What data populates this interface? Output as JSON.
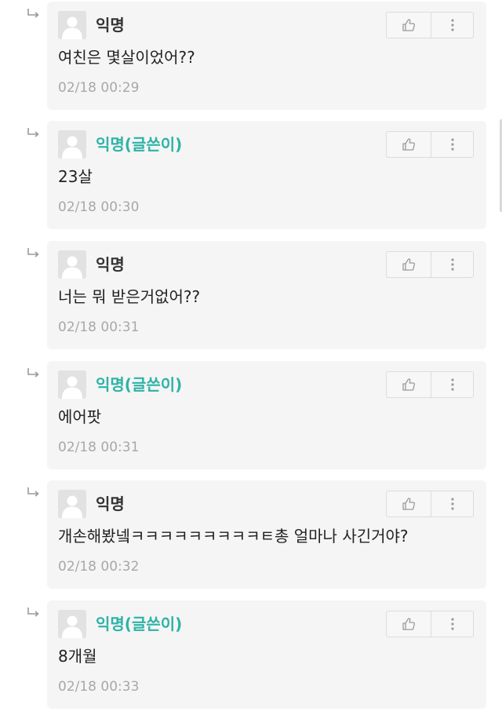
{
  "comments": [
    {
      "nickname": "익명",
      "is_writer": false,
      "text": "여친은 몇살이었어??",
      "time": "02/18 00:29"
    },
    {
      "nickname": "익명(글쓴이)",
      "is_writer": true,
      "text": "23살",
      "time": "02/18 00:30"
    },
    {
      "nickname": "익명",
      "is_writer": false,
      "text": "너는 뭐 받은거없어??",
      "time": "02/18 00:31"
    },
    {
      "nickname": "익명(글쓴이)",
      "is_writer": true,
      "text": "에어팟",
      "time": "02/18 00:31"
    },
    {
      "nickname": "익명",
      "is_writer": false,
      "text": "개손해봤넼ㅋㅋㅋㅋㅋㅋㅋㅋㅋㅌ총 얼마나 사긴거야?",
      "time": "02/18 00:32"
    },
    {
      "nickname": "익명(글쓴이)",
      "is_writer": true,
      "text": "8개월",
      "time": "02/18 00:33"
    }
  ],
  "icons": {
    "reply": "reply-arrow-icon",
    "avatar": "default-avatar-icon",
    "like": "thumbs-up-icon",
    "more": "more-vertical-icon"
  },
  "colors": {
    "writer_nickname": "#2db3a6",
    "nickname": "#333333",
    "timestamp": "#a8a8a8",
    "card_background": "#f5f5f5"
  }
}
